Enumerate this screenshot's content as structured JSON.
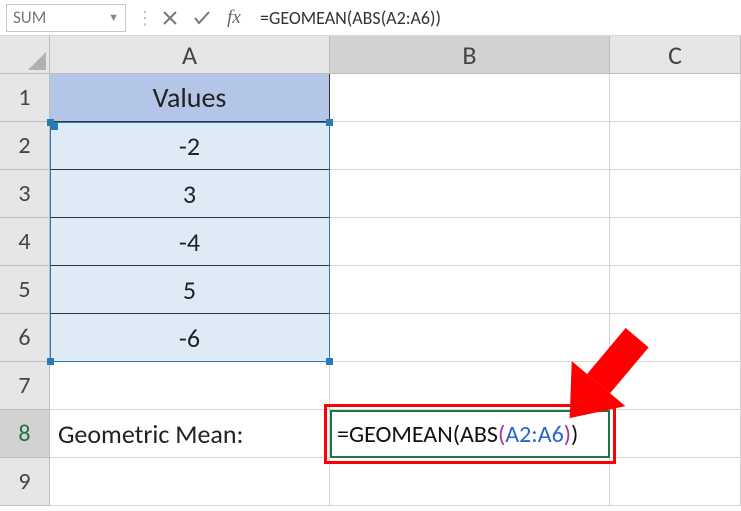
{
  "formula_bar": {
    "name_box": "SUM",
    "cancel_title": "Cancel",
    "enter_title": "Enter",
    "fx_label": "fx",
    "formula_text": "=GEOMEAN(ABS(A2:A6))"
  },
  "columns": [
    "A",
    "B",
    "C"
  ],
  "rows": [
    "1",
    "2",
    "3",
    "4",
    "5",
    "6",
    "7",
    "8",
    "9"
  ],
  "cells": {
    "A1": "Values",
    "A2": "-2",
    "A3": "3",
    "A4": "-4",
    "A5": "5",
    "A6": "-6",
    "A8": "Geometric Mean:"
  },
  "editing": {
    "plain1": "=GEOMEAN",
    "open1": "(",
    "plain2": "ABS",
    "open2": "(",
    "ref": "A2:A6",
    "close2": ")",
    "close1": ")"
  }
}
